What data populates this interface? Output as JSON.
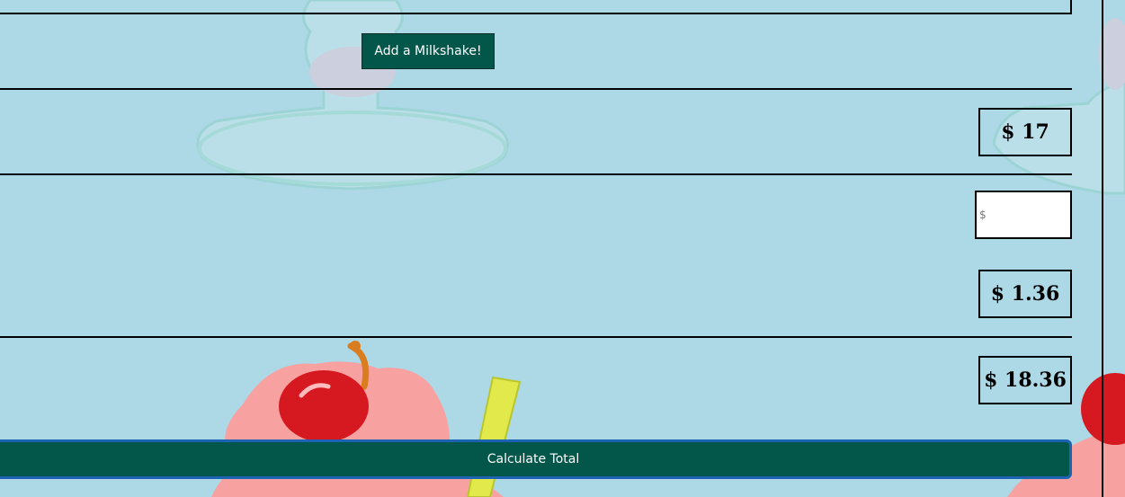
{
  "form": {
    "add_milkshake_label": "Add a Milkshake!",
    "subtotal": "$ 17",
    "tip_placeholder": "$",
    "tax": "$ 1.36",
    "total": "$ 18.36",
    "calculate_label": "Calculate Total"
  }
}
